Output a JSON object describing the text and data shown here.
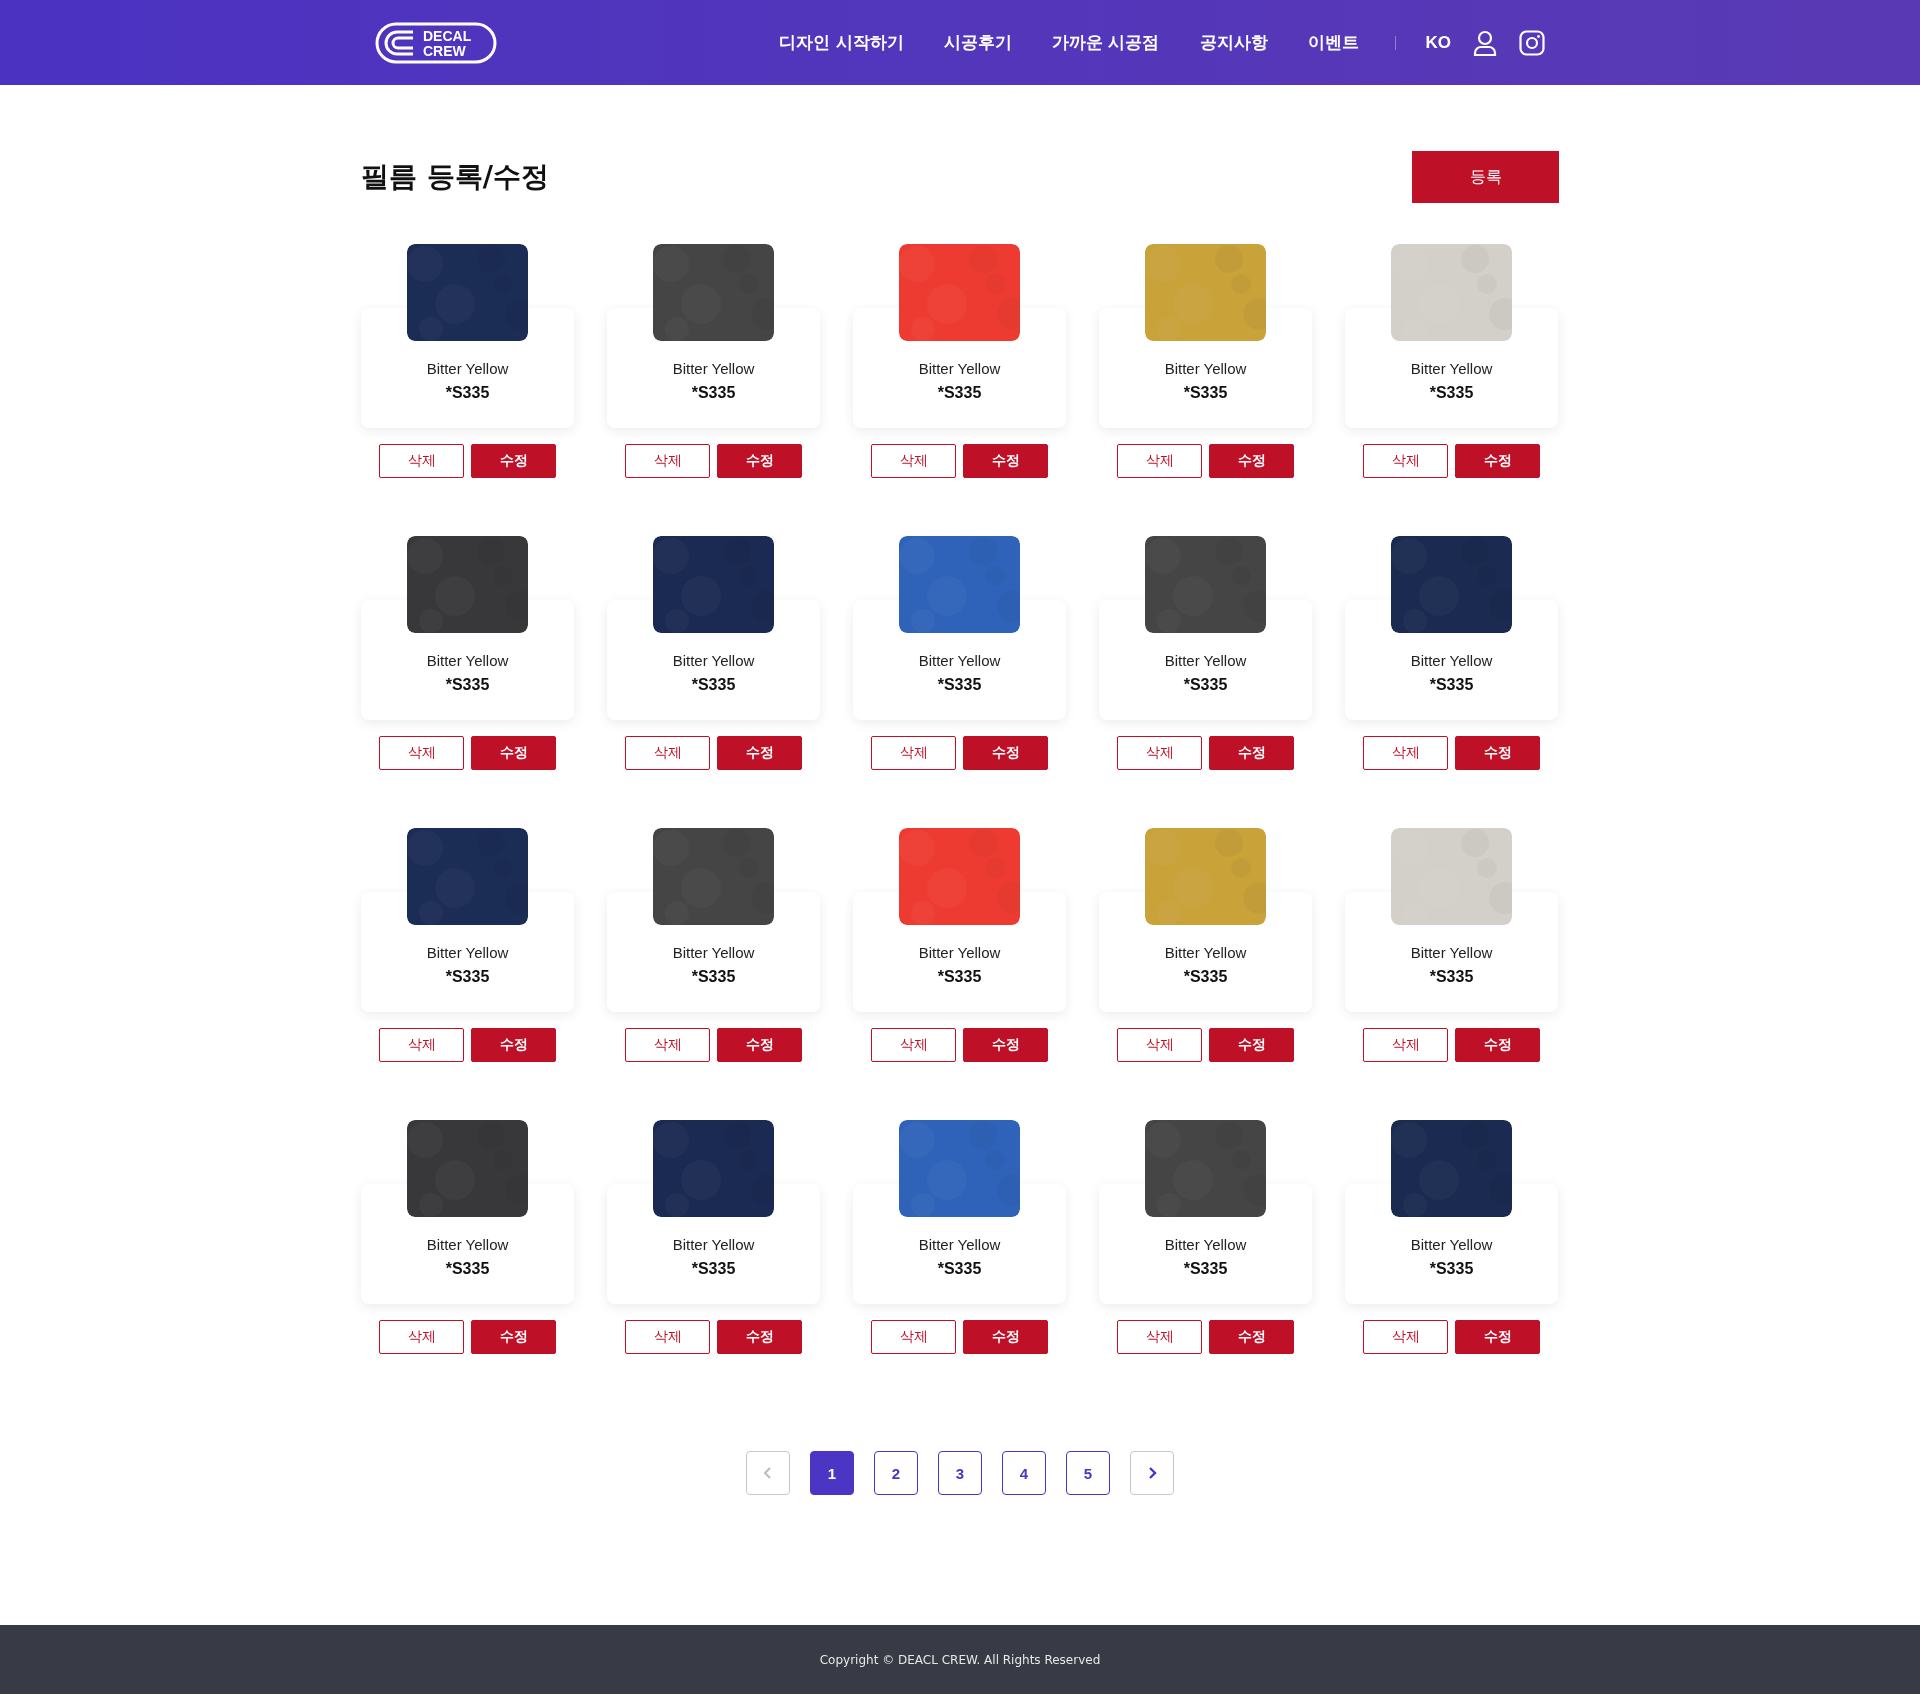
{
  "header": {
    "logo": [
      "DECAL",
      "CREW"
    ],
    "nav": [
      "디자인 시작하기",
      "시공후기",
      "가까운 시공점",
      "공지사항",
      "이벤트"
    ],
    "language": "KO"
  },
  "page_title": "필름 등록/수정",
  "register_button": "등록",
  "films": [
    {
      "name": "Bitter Yellow",
      "code": "*S335",
      "color": "#1b2c55",
      "delete": "삭제",
      "edit": "수정"
    },
    {
      "name": "Bitter Yellow",
      "code": "*S335",
      "color": "#454545",
      "delete": "삭제",
      "edit": "수정"
    },
    {
      "name": "Bitter Yellow",
      "code": "*S335",
      "color": "#ee3b32",
      "delete": "삭제",
      "edit": "수정"
    },
    {
      "name": "Bitter Yellow",
      "code": "*S335",
      "color": "#c9a23a",
      "delete": "삭제",
      "edit": "수정"
    },
    {
      "name": "Bitter Yellow",
      "code": "*S335",
      "color": "#d3d0ca",
      "delete": "삭제",
      "edit": "수정"
    },
    {
      "name": "Bitter Yellow",
      "code": "*S335",
      "color": "#38383a",
      "delete": "삭제",
      "edit": "수정"
    },
    {
      "name": "Bitter Yellow",
      "code": "*S335",
      "color": "#1b2a52",
      "delete": "삭제",
      "edit": "수정"
    },
    {
      "name": "Bitter Yellow",
      "code": "*S335",
      "color": "#2f63b9",
      "delete": "삭제",
      "edit": "수정"
    },
    {
      "name": "Bitter Yellow",
      "code": "*S335",
      "color": "#454545",
      "delete": "삭제",
      "edit": "수정"
    },
    {
      "name": "Bitter Yellow",
      "code": "*S335",
      "color": "#1a2a50",
      "delete": "삭제",
      "edit": "수정"
    },
    {
      "name": "Bitter Yellow",
      "code": "*S335",
      "color": "#1b2c55",
      "delete": "삭제",
      "edit": "수정"
    },
    {
      "name": "Bitter Yellow",
      "code": "*S335",
      "color": "#454545",
      "delete": "삭제",
      "edit": "수정"
    },
    {
      "name": "Bitter Yellow",
      "code": "*S335",
      "color": "#ee3b32",
      "delete": "삭제",
      "edit": "수정"
    },
    {
      "name": "Bitter Yellow",
      "code": "*S335",
      "color": "#c9a23a",
      "delete": "삭제",
      "edit": "수정"
    },
    {
      "name": "Bitter Yellow",
      "code": "*S335",
      "color": "#d3d0ca",
      "delete": "삭제",
      "edit": "수정"
    },
    {
      "name": "Bitter Yellow",
      "code": "*S335",
      "color": "#38383a",
      "delete": "삭제",
      "edit": "수정"
    },
    {
      "name": "Bitter Yellow",
      "code": "*S335",
      "color": "#1b2a52",
      "delete": "삭제",
      "edit": "수정"
    },
    {
      "name": "Bitter Yellow",
      "code": "*S335",
      "color": "#2f63b9",
      "delete": "삭제",
      "edit": "수정"
    },
    {
      "name": "Bitter Yellow",
      "code": "*S335",
      "color": "#454545",
      "delete": "삭제",
      "edit": "수정"
    },
    {
      "name": "Bitter Yellow",
      "code": "*S335",
      "color": "#1a2a50",
      "delete": "삭제",
      "edit": "수정"
    }
  ],
  "pagination": {
    "prev": {
      "disabled": true
    },
    "pages": [
      {
        "label": "1",
        "selected": true
      },
      {
        "label": "2",
        "selected": false
      },
      {
        "label": "3",
        "selected": false
      },
      {
        "label": "4",
        "selected": false
      },
      {
        "label": "5",
        "selected": false
      }
    ],
    "next": {
      "disabled": false
    }
  },
  "footer": "Copyright © DEACL CREW. All Rights Reserved"
}
